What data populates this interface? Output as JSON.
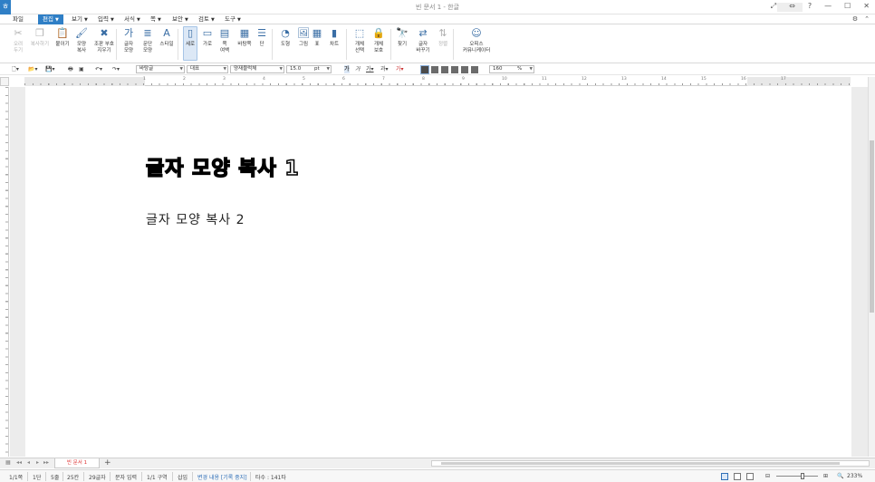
{
  "window": {
    "title": "빈 문서 1 - 한글",
    "controls": [
      "⤢",
      "⇔",
      "?",
      "—",
      "☐",
      "✕"
    ]
  },
  "menu": {
    "file": "파일",
    "items": [
      {
        "label": "편집",
        "active": true
      },
      {
        "label": "보기"
      },
      {
        "label": "입력"
      },
      {
        "label": "서식"
      },
      {
        "label": "쪽"
      },
      {
        "label": "보안"
      },
      {
        "label": "검토"
      },
      {
        "label": "도구"
      }
    ]
  },
  "ribbon": [
    {
      "label": "오려\n두기",
      "icon": "scissors-icon",
      "glyph": "✂",
      "disabled": true
    },
    {
      "label": "복사하기",
      "icon": "copy-icon",
      "glyph": "❐",
      "disabled": true
    },
    {
      "label": "붙이기",
      "icon": "paste-icon",
      "glyph": "📋"
    },
    {
      "label": "모양\n복사",
      "icon": "format-painter-icon",
      "glyph": "🖌"
    },
    {
      "label": "조판 부호\n지우기",
      "icon": "clear-codes-icon",
      "glyph": "✖"
    },
    {
      "label": "글자\n모양",
      "icon": "char-shape-icon",
      "glyph": "가"
    },
    {
      "label": "문단\n모양",
      "icon": "para-shape-icon",
      "glyph": "≣"
    },
    {
      "label": "스타일",
      "icon": "style-icon",
      "glyph": "A"
    },
    {
      "label": "세로",
      "icon": "portrait-icon",
      "glyph": "▯",
      "selected": true
    },
    {
      "label": "가로",
      "icon": "landscape-icon",
      "glyph": "▭"
    },
    {
      "label": "쪽\n여백",
      "icon": "page-margin-icon",
      "glyph": "▤"
    },
    {
      "label": "바탕쪽",
      "icon": "master-page-icon",
      "glyph": "▦"
    },
    {
      "label": "단",
      "icon": "columns-icon",
      "glyph": "☰"
    },
    {
      "label": "도형",
      "icon": "shape-icon",
      "glyph": "◔"
    },
    {
      "label": "그림",
      "icon": "picture-icon",
      "glyph": "🖼"
    },
    {
      "label": "표",
      "icon": "table-icon",
      "glyph": "▦"
    },
    {
      "label": "차트",
      "icon": "chart-icon",
      "glyph": "▮"
    },
    {
      "label": "개체\n선택",
      "icon": "select-object-icon",
      "glyph": "⬚"
    },
    {
      "label": "개체\n보호",
      "icon": "protect-object-icon",
      "glyph": "🔒"
    },
    {
      "label": "찾기",
      "icon": "find-icon",
      "glyph": "🔭"
    },
    {
      "label": "글자\n바꾸기",
      "icon": "replace-icon",
      "glyph": "⇄"
    },
    {
      "label": "정렬",
      "icon": "sort-icon",
      "glyph": "⇅",
      "disabled": true
    },
    {
      "label": "오피스\n커뮤니케이터",
      "icon": "office-communicator-icon",
      "glyph": "☺"
    }
  ],
  "format": {
    "style": "바탕글",
    "lang": "대표",
    "font": "양재블럭체",
    "size": "15.0",
    "unit": "pt",
    "line_spacing": "160",
    "percent": "%"
  },
  "ruler": {
    "numbers": [
      "1",
      "2",
      "3",
      "4",
      "5",
      "6",
      "7",
      "8",
      "9",
      "10",
      "11",
      "12",
      "13",
      "14",
      "15",
      "16",
      "17"
    ]
  },
  "document": {
    "line1": "글자 모양 복사 1",
    "line2": "글자 모양 복사 2"
  },
  "tab": {
    "label": "빈 문서 1",
    "add": "+"
  },
  "status": {
    "page": "1/1쪽",
    "section_col": "1단",
    "line": "5줄",
    "col": "25칸",
    "chars": "29글자",
    "mode": "문자 입력",
    "section": "1/1 구역",
    "insert": "삽입",
    "track": "변경 내용 [기록 중지]",
    "typing": "타수 : 141타",
    "zoom": "233%"
  }
}
